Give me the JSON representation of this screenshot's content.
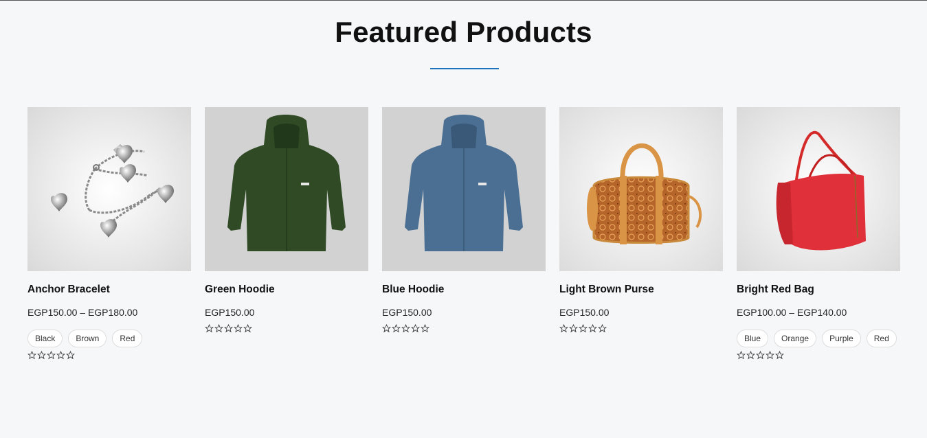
{
  "section": {
    "title": "Featured Products",
    "accent_color": "#1e73be"
  },
  "products": [
    {
      "name": "Anchor Bracelet",
      "price": "EGP150.00 – EGP180.00",
      "image": "silver-heart-charm-bracelet",
      "swatches": [
        "Black",
        "Brown",
        "Red"
      ],
      "rating_stars": 0
    },
    {
      "name": "Green Hoodie",
      "price": "EGP150.00",
      "image": "green-hoodie",
      "swatches": [],
      "rating_stars": 0
    },
    {
      "name": "Blue Hoodie",
      "price": "EGP150.00",
      "image": "blue-hoodie",
      "swatches": [],
      "rating_stars": 0
    },
    {
      "name": "Light Brown Purse",
      "price": "EGP150.00",
      "image": "brown-leather-purse",
      "swatches": [],
      "rating_stars": 0
    },
    {
      "name": "Bright Red Bag",
      "price": "EGP100.00 – EGP140.00",
      "image": "red-handbag",
      "swatches": [
        "Blue",
        "Orange",
        "Purple",
        "Red"
      ],
      "rating_stars": 0
    }
  ]
}
